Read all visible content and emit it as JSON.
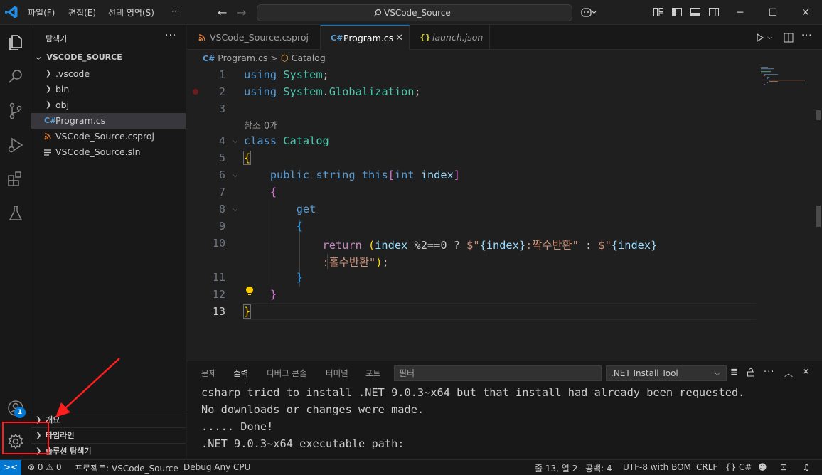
{
  "titlebar": {
    "menus": [
      "파일(F)",
      "편집(E)",
      "선택 영역(S)",
      "···"
    ],
    "search": "VSCode_Source"
  },
  "sidebar": {
    "title": "탐색기",
    "more": "···",
    "root": "VSCODE_SOURCE",
    "items": [
      {
        "label": ".vscode",
        "type": "folder"
      },
      {
        "label": "bin",
        "type": "folder"
      },
      {
        "label": "obj",
        "type": "folder"
      },
      {
        "label": "Program.cs",
        "type": "csharp",
        "icon": "C#"
      },
      {
        "label": "VSCode_Source.csproj",
        "type": "rss",
        "icon": "rss-icon"
      },
      {
        "label": "VSCode_Source.sln",
        "type": "lines",
        "icon": "lines-icon"
      }
    ],
    "sections": [
      "개요",
      "타임라인",
      "솔루션 탐색기"
    ]
  },
  "accounts_badge": "1",
  "tabs": [
    {
      "label": "VSCode_Source.csproj",
      "active": false
    },
    {
      "label": "Program.cs",
      "active": true
    },
    {
      "label": "launch.json",
      "active": false,
      "icon": "{}"
    }
  ],
  "breadcrumb": {
    "file": "Program.cs",
    "sep": ">",
    "symbol": "Catalog"
  },
  "editor": {
    "line_numbers": [
      "1",
      "2",
      "3",
      "4",
      "5",
      "6",
      "7",
      "8",
      "9",
      "10",
      "11",
      "12",
      "13"
    ],
    "codelens": "참조 0개",
    "line1": {
      "kw": "using",
      "ns": "System",
      "end": ";"
    },
    "line2": {
      "kw": "using",
      "ns1": "System",
      "dot": ".",
      "ns2": "Globalization",
      "end": ";"
    },
    "line4": {
      "kw": "class",
      "name": "Catalog"
    },
    "line5": "{",
    "line6": {
      "mod": "public",
      "type": "string",
      "this": "this",
      "lb": "[",
      "ptype": "int",
      "pname": "index",
      "rb": "]"
    },
    "line7": "{",
    "line8": "get",
    "line9": "{",
    "line10": {
      "ret": "return",
      "lp": "(",
      "var": "index",
      "op": " %2==0 ? ",
      "s1a": "$\"",
      "i1": "{index}",
      "s1b": ":짝수반환\"",
      "colon": " : ",
      "s2a": "$\"",
      "i2": "{index}"
    },
    "line10b": {
      "s2b": ":홀수반환\"",
      "rp": ")",
      "end": ";"
    },
    "line11": "}",
    "line12": "}",
    "line13": "}"
  },
  "panel": {
    "tabs": [
      "문제",
      "출력",
      "디버그 콘솔",
      "터미널",
      "포트"
    ],
    "filter_placeholder": "필터",
    "channel": ".NET Install Tool",
    "output": [
      "csharp tried to install .NET 9.0.3~x64 but that install had already been requested.",
      "No downloads or changes were made.",
      "..... Done!",
      ".NET 9.0.3~x64 executable path:"
    ]
  },
  "statusbar": {
    "remote": "><",
    "errors": "0",
    "warnings": "0",
    "project": "프로젝트: VSCode_Source",
    "debug": "Debug Any CPU",
    "position": "줄 13, 열 2",
    "spaces": "공백: 4",
    "encoding": "UTF-8 with BOM",
    "eol": "CRLF",
    "lang_braces": "{}",
    "language": "C#"
  },
  "colors": {
    "accent": "#0078d4",
    "annotation": "#ff1e1e"
  }
}
